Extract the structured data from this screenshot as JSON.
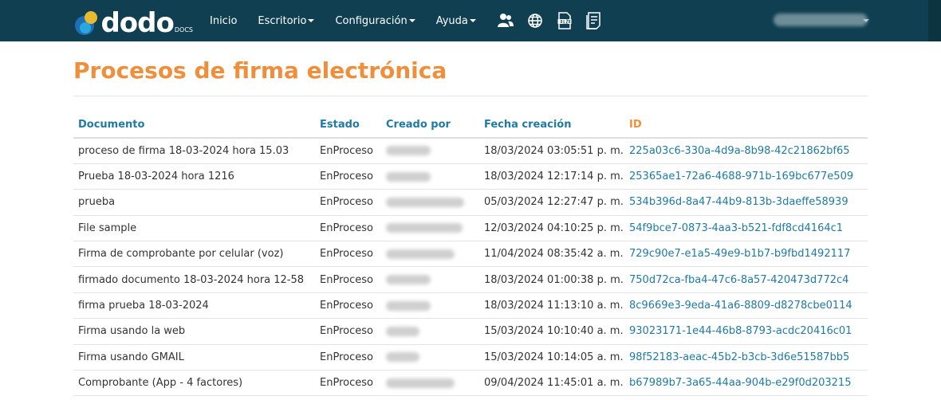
{
  "nav": {
    "logo": {
      "text": "dodo",
      "sub": "DOCS"
    },
    "items": [
      {
        "label": "Inicio",
        "dropdown": false
      },
      {
        "label": "Escritorio",
        "dropdown": true
      },
      {
        "label": "Configuración",
        "dropdown": true
      },
      {
        "label": "Ayuda",
        "dropdown": true
      }
    ],
    "icons": [
      "users-icon",
      "globe-icon",
      "xlsx-file-icon",
      "document-list-icon"
    ],
    "user": "redacted"
  },
  "page": {
    "title": "Procesos de firma electrónica"
  },
  "table": {
    "headers": {
      "documento": "Documento",
      "estado": "Estado",
      "creado_por": "Creado por",
      "fecha": "Fecha creación",
      "id": "ID"
    },
    "rows": [
      {
        "documento": "proceso de firma 18-03-2024 hora 15.03",
        "estado": "EnProceso",
        "fecha": "18/03/2024 03:05:51 p. m.",
        "id": "225a03c6-330a-4d9a-8b98-42c21862bf65"
      },
      {
        "documento": "Prueba 18-03-2024 hora 1216",
        "estado": "EnProceso",
        "fecha": "18/03/2024 12:17:14 p. m.",
        "id": "25365ae1-72a6-4688-971b-169bc677e509"
      },
      {
        "documento": "prueba",
        "estado": "EnProceso",
        "fecha": "05/03/2024 12:27:47 p. m.",
        "id": "534b396d-8a47-44b9-813b-3daeffe58939"
      },
      {
        "documento": "File sample",
        "estado": "EnProceso",
        "fecha": "12/03/2024 04:10:25 p. m.",
        "id": "54f9bce7-0873-4aa3-b521-fdf8cd4164c1"
      },
      {
        "documento": "Firma de comprobante por celular (voz)",
        "estado": "EnProceso",
        "fecha": "11/04/2024 08:35:42 a. m.",
        "id": "729c90e7-e1a5-49e9-b1b7-b9fbd1492117"
      },
      {
        "documento": "firmado documento 18-03-2024 hora 12-58",
        "estado": "EnProceso",
        "fecha": "18/03/2024 01:00:38 p. m.",
        "id": "750d72ca-fba4-47c6-8a57-420473d772c4"
      },
      {
        "documento": "firma prueba 18-03-2024",
        "estado": "EnProceso",
        "fecha": "18/03/2024 11:13:10 a. m.",
        "id": "8c9669e3-9eda-41a6-8809-d8278cbe0114"
      },
      {
        "documento": "Firma usando la web",
        "estado": "EnProceso",
        "fecha": "15/03/2024 10:10:40 a. m.",
        "id": "93023171-1e44-46b8-8793-acdc20416c01"
      },
      {
        "documento": "Firma usando GMAIL",
        "estado": "EnProceso",
        "fecha": "15/03/2024 10:14:05 a. m.",
        "id": "98f52183-aeac-45b2-b3cb-3d6e51587bb5"
      },
      {
        "documento": "Comprobante (App - 4 factores)",
        "estado": "EnProceso",
        "fecha": "09/04/2024 11:45:01 a. m.",
        "id": "b67989b7-3a65-44aa-904b-e29f0d203215"
      }
    ]
  },
  "colors": {
    "navbar": "#0f3f50",
    "title": "#ef8f3b",
    "header": "#1f7aa4",
    "link": "#1f7aa4"
  }
}
